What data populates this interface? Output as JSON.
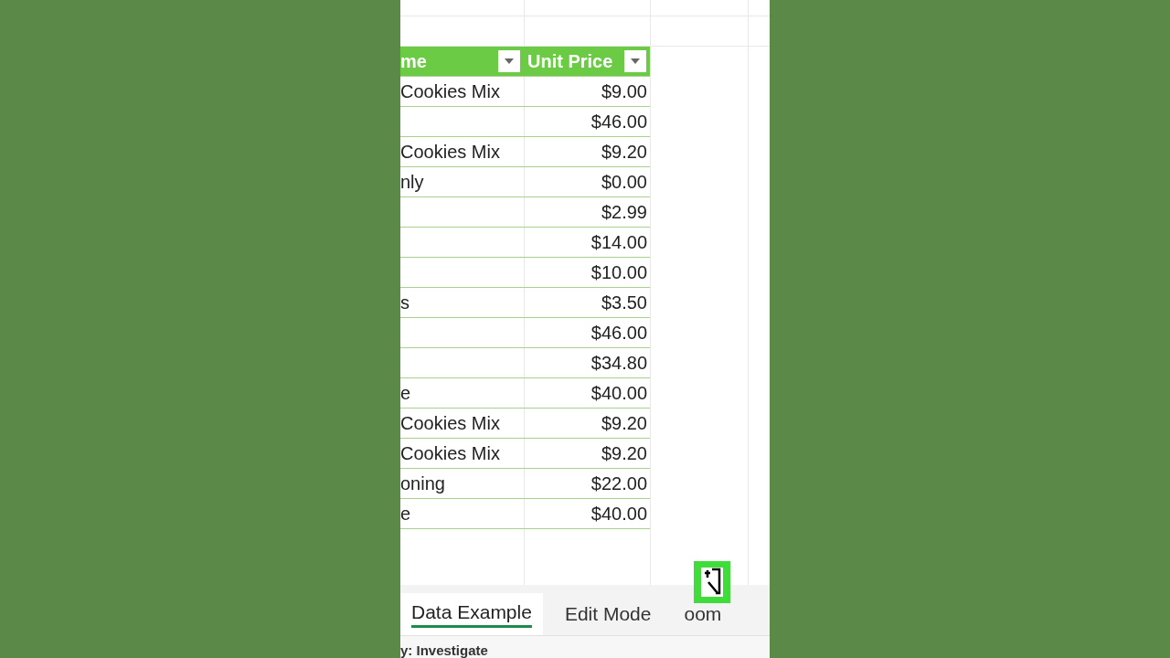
{
  "table": {
    "columns": [
      {
        "label": "me",
        "filter": true
      },
      {
        "label": "Unit Price",
        "filter": true
      }
    ],
    "rows": [
      [
        "Cookies Mix",
        "$9.00"
      ],
      [
        "",
        "$46.00"
      ],
      [
        "Cookies Mix",
        "$9.20"
      ],
      [
        "nly",
        "$0.00"
      ],
      [
        "",
        "$2.99"
      ],
      [
        "",
        "$14.00"
      ],
      [
        "",
        "$10.00"
      ],
      [
        "s",
        "$3.50"
      ],
      [
        "",
        "$46.00"
      ],
      [
        "",
        "$34.80"
      ],
      [
        "e",
        "$40.00"
      ],
      [
        "Cookies Mix",
        "$9.20"
      ],
      [
        "Cookies Mix",
        "$9.20"
      ],
      [
        "oning",
        "$22.00"
      ],
      [
        "e",
        "$40.00"
      ]
    ]
  },
  "sheet_tabs": [
    {
      "label": "Data Example",
      "selected": true
    },
    {
      "label": "Edit Mode",
      "selected": false
    },
    {
      "label": "oom",
      "selected": false
    }
  ],
  "status_bar": {
    "text": "y: Investigate"
  }
}
